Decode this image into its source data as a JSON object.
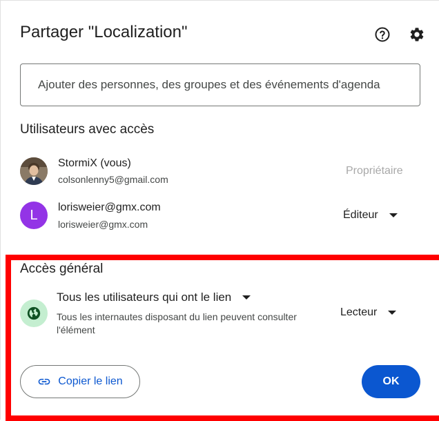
{
  "dialog": {
    "title": "Partager \"Localization\"",
    "icons": {
      "help": "help-circle-icon",
      "settings": "gear-icon"
    }
  },
  "add_people": {
    "placeholder": "Ajouter des personnes, des groupes et des événements d'agenda"
  },
  "users_section": {
    "title": "Utilisateurs avec accès",
    "users": [
      {
        "name": "StormiX (vous)",
        "email": "colsonlenny5@gmail.com",
        "role": "Propriétaire"
      },
      {
        "avatar_letter": "L",
        "avatar_color": "#9334e6",
        "name": "lorisweier@gmx.com",
        "email": "lorisweier@gmx.com",
        "role": "Éditeur"
      }
    ]
  },
  "general_access": {
    "title": "Accès général",
    "access_option": "Tous les utilisateurs qui ont le lien",
    "description": "Tous les internautes disposant du lien peuvent consulter l'élément",
    "role": "Lecteur"
  },
  "footer": {
    "copy_link_label": "Copier le lien",
    "ok_label": "OK"
  },
  "colors": {
    "accent": "#0b57d0",
    "highlight": "#ff0000",
    "globe_bg": "#c4eed0"
  }
}
